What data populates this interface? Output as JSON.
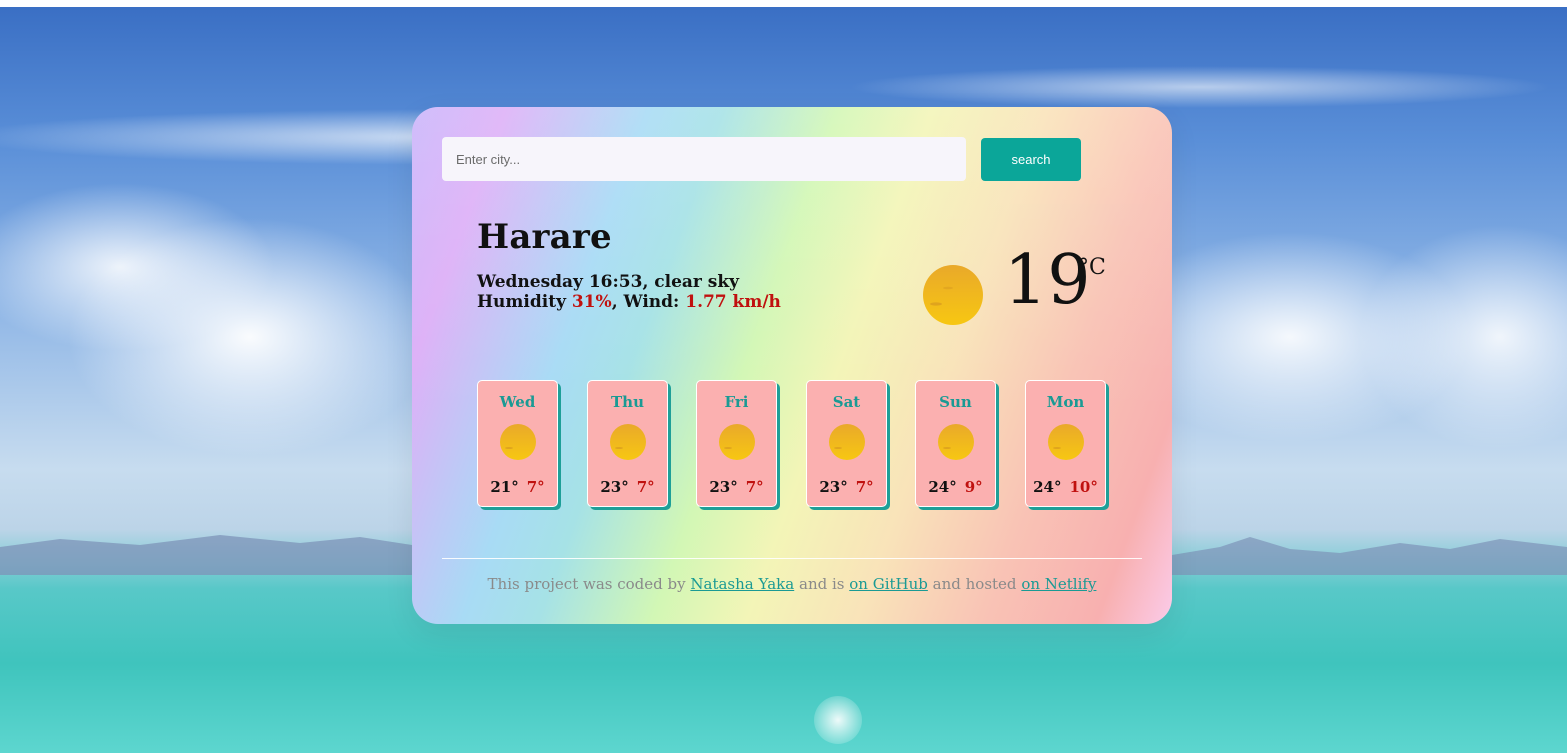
{
  "search": {
    "placeholder": "Enter city...",
    "value": "",
    "button_label": "search"
  },
  "current": {
    "city": "Harare",
    "day_time_desc": "Wednesday 16:53, clear sky",
    "humidity_label": "Humidity",
    "humidity_value": "31%",
    "wind_label": "Wind:",
    "wind_value": "1.77 km/h",
    "temperature": "19",
    "unit": "°C",
    "icon": "sun-icon"
  },
  "forecast": [
    {
      "day": "Wed",
      "max": "21°",
      "min": "7°",
      "icon": "sun-icon"
    },
    {
      "day": "Thu",
      "max": "23°",
      "min": "7°",
      "icon": "sun-icon"
    },
    {
      "day": "Fri",
      "max": "23°",
      "min": "7°",
      "icon": "sun-icon"
    },
    {
      "day": "Sat",
      "max": "23°",
      "min": "7°",
      "icon": "sun-icon"
    },
    {
      "day": "Sun",
      "max": "24°",
      "min": "9°",
      "icon": "sun-icon"
    },
    {
      "day": "Mon",
      "max": "24°",
      "min": "10°",
      "icon": "sun-icon"
    }
  ],
  "footer": {
    "text_1": "This project was coded by",
    "author_link": "Natasha Yaka",
    "text_2": "and is",
    "github_link": "on GitHub",
    "text_3": "and hosted",
    "netlify_link": "on Netlify"
  },
  "colors": {
    "accent": "#0ba699",
    "forecast_card": "#fbb0b0",
    "low_temp": "#c0110f",
    "day_name": "#1a9a94"
  }
}
